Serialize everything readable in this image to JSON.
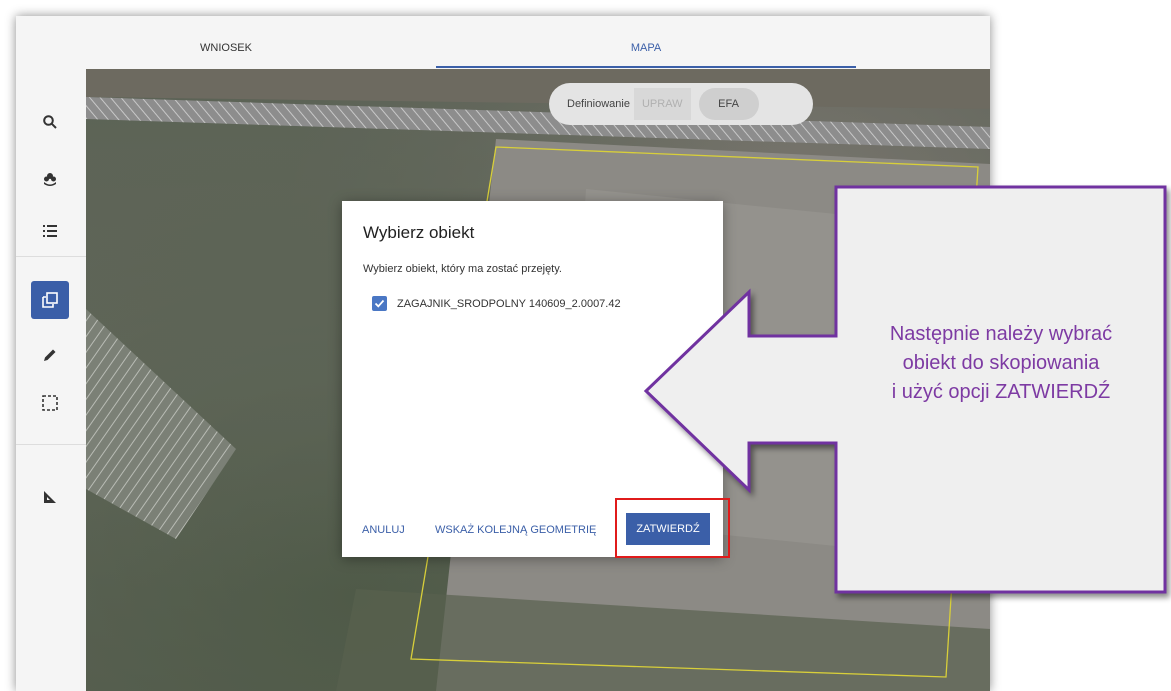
{
  "tabs": [
    {
      "label": "WNIOSEK",
      "active": false
    },
    {
      "label": "MAPA",
      "active": true
    }
  ],
  "sidebar": {
    "tools": [
      {
        "icon": "search-icon"
      },
      {
        "icon": "crop-plant-icon"
      },
      {
        "icon": "list-icon"
      },
      {
        "icon": "copy-geometry-icon",
        "active": true
      },
      {
        "icon": "pencil-icon"
      },
      {
        "icon": "select-area-icon"
      },
      {
        "icon": "measure-icon"
      }
    ]
  },
  "map": {
    "toggle": {
      "label": "Definiowanie",
      "option_1": "UPRAW",
      "option_2": "EFA"
    }
  },
  "dialog": {
    "title": "Wybierz obiekt",
    "description": "Wybierz obiekt, który ma zostać przejęty.",
    "option": {
      "label": "ZAGAJNIK_SRODPOLNY 140609_2.0007.42",
      "checked": true
    },
    "buttons": {
      "cancel": "ANULUJ",
      "next_geometry": "WSKAŻ KOLEJNĄ GEOMETRIĘ",
      "confirm": "ZATWIERDŹ"
    }
  },
  "callout": {
    "line1": "Następnie należy wybrać",
    "line2": "obiekt do skopiowania",
    "line3": "i użyć opcji ZATWIERDŹ"
  },
  "colors": {
    "accent": "#3b5fa8",
    "highlight": "#e01b1b",
    "callout_text": "#7d3aa3",
    "callout_border": "#7030a0"
  }
}
